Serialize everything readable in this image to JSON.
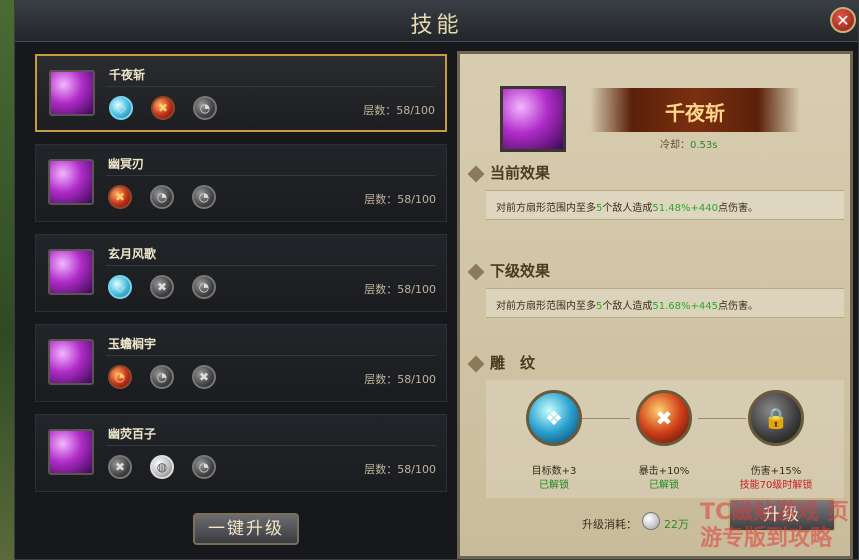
{
  "window": {
    "title": "技能",
    "close_label": "✕"
  },
  "skills": [
    {
      "name": "千夜斩",
      "level": "层数：58/100",
      "orbs": [
        {
          "type": "blue",
          "glyph": "◇"
        },
        {
          "type": "red",
          "glyph": "✖"
        },
        {
          "type": "gray",
          "glyph": "◔"
        }
      ]
    },
    {
      "name": "幽冥刃",
      "level": "层数：58/100",
      "orbs": [
        {
          "type": "red",
          "glyph": "✖"
        },
        {
          "type": "gray",
          "glyph": "◔"
        },
        {
          "type": "gray",
          "glyph": "◔"
        }
      ]
    },
    {
      "name": "玄月风歌",
      "level": "层数：58/100",
      "orbs": [
        {
          "type": "blue",
          "glyph": "◇"
        },
        {
          "type": "gray",
          "glyph": "✖"
        },
        {
          "type": "gray",
          "glyph": "◔"
        }
      ]
    },
    {
      "name": "玉蟾榈宇",
      "level": "层数：58/100",
      "orbs": [
        {
          "type": "red",
          "glyph": "◔"
        },
        {
          "type": "gray",
          "glyph": "◔"
        },
        {
          "type": "gray",
          "glyph": "✖"
        }
      ]
    },
    {
      "name": "幽荧百子",
      "level": "层数：58/100",
      "orbs": [
        {
          "type": "gray",
          "glyph": "✖"
        },
        {
          "type": "white",
          "glyph": "◍"
        },
        {
          "type": "gray",
          "glyph": "◔"
        }
      ]
    }
  ],
  "upgrade_all_label": "一键升级",
  "detail": {
    "skill_name": "千夜斩",
    "cooldown_label": "冷却：",
    "cooldown_value": "0.53s",
    "current_title": "当前效果",
    "current_pre": "对前方扇形范围内至多",
    "current_num": "5",
    "current_mid": "个敌人造成",
    "current_dmg": "51.48%+440",
    "current_post": "点伤害。",
    "next_title": "下级效果",
    "next_pre": "对前方扇形范围内至多",
    "next_num": "5",
    "next_mid": "个敌人造成",
    "next_dmg": "51.68%+445",
    "next_post": "点伤害。",
    "glyph_title": "雕　纹",
    "glyphs": [
      {
        "label": "目标数+3",
        "status": "已解锁",
        "state": "ok",
        "type": "blue",
        "glyph": "❖"
      },
      {
        "label": "暴击+10%",
        "status": "已解锁",
        "state": "ok",
        "type": "red",
        "glyph": "✖"
      },
      {
        "label": "伤害+15%",
        "status": "技能70级时解锁",
        "state": "bad",
        "type": "lock",
        "glyph": "🔒"
      }
    ],
    "cost_label": "升级消耗：",
    "cost_value": "22万",
    "upgrade_label": "升级"
  },
  "watermark": "TC磁贴游戏 页游专版到攻略"
}
